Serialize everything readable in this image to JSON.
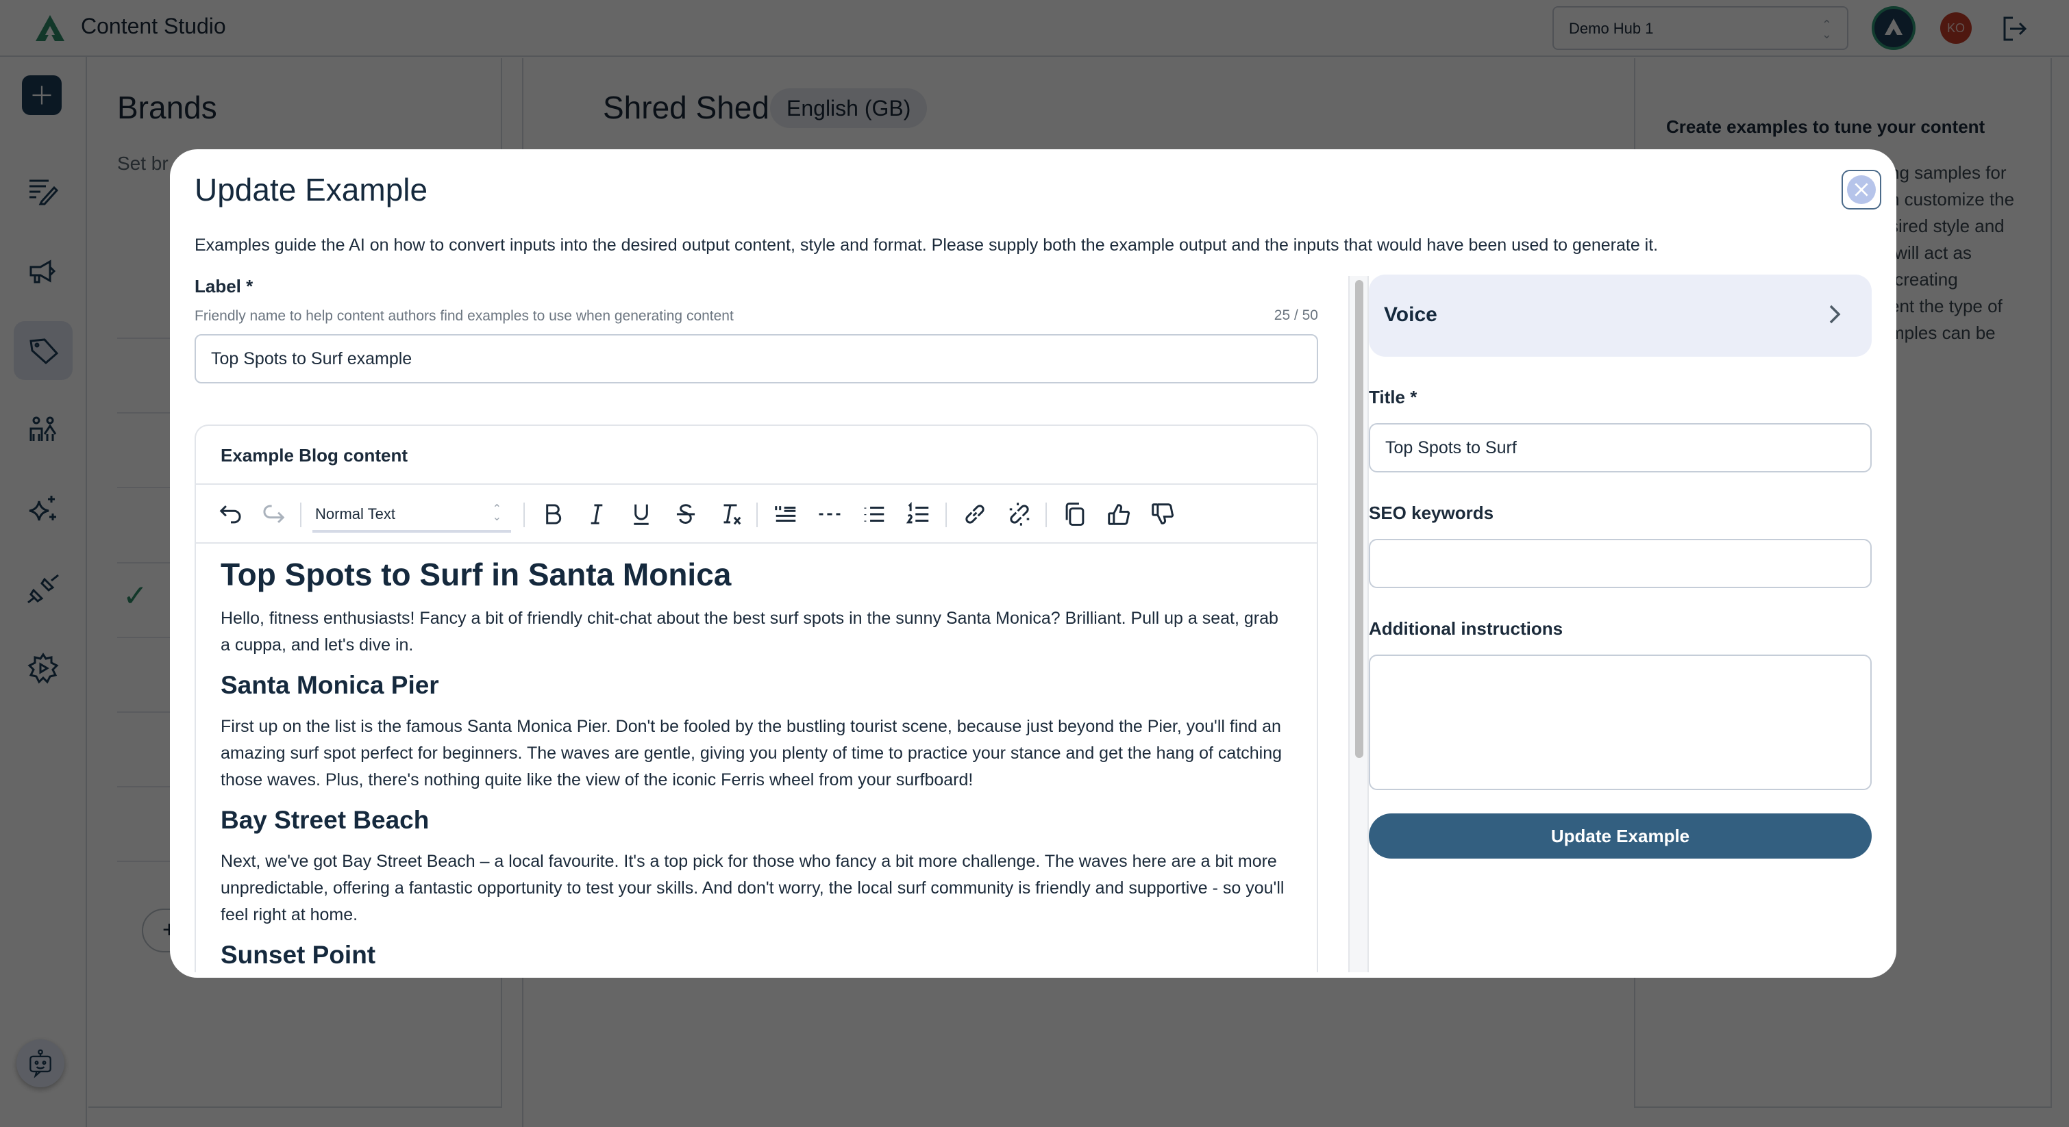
{
  "header": {
    "app_title": "Content Studio",
    "hub_select": {
      "value": "Demo Hub 1"
    },
    "user_initials": "KO"
  },
  "rail": {
    "items": [
      {
        "name": "new",
        "icon": "plus-icon"
      },
      {
        "name": "content",
        "icon": "edit-list-icon"
      },
      {
        "name": "campaigns",
        "icon": "megaphone-icon"
      },
      {
        "name": "brands",
        "icon": "tag-icon",
        "active": true
      },
      {
        "name": "audiences",
        "icon": "people-icon"
      },
      {
        "name": "ai",
        "icon": "sparkles-icon"
      },
      {
        "name": "integrations",
        "icon": "plug-icon"
      },
      {
        "name": "settings",
        "icon": "settings-gear-icon"
      }
    ],
    "assistant_icon": "robot-chat-icon"
  },
  "brands_panel": {
    "title": "Brands",
    "description": "Set br… conte…",
    "add_label": "+"
  },
  "middle_panel": {
    "brand_name": "Shred Shed",
    "language": "English (GB)"
  },
  "right_panel": {
    "title": "Create examples to tune your content",
    "description_lines": [
      "…ng samples for",
      "…n customize the",
      "…sired style and",
      "… will act as",
      "… creating",
      "…ent the type of",
      "…mples can be"
    ]
  },
  "modal": {
    "title": "Update Example",
    "description": "Examples guide the AI on how to convert inputs into the desired output content, style and format. Please supply both the example output and the inputs that would have been used to generate it.",
    "label_field": {
      "label": "Label *",
      "help": "Friendly name to help content authors find examples to use when generating content",
      "counter": "25 / 50",
      "value": "Top Spots to Surf example"
    },
    "editor": {
      "label": "Example Blog content",
      "text_style": "Normal Text",
      "content": {
        "h1": "Top Spots to Surf in Santa Monica",
        "p1": "Hello, fitness enthusiasts! Fancy a bit of friendly chit-chat about the best surf spots in the sunny Santa Monica? Brilliant. Pull up a seat, grab a cuppa, and let's dive in.",
        "h2a": "Santa Monica Pier",
        "p2": "First up on the list is the famous Santa Monica Pier. Don't be fooled by the bustling tourist scene, because just beyond the Pier, you'll find an amazing surf spot perfect for beginners. The waves are gentle, giving you plenty of time to practice your stance and get the hang of catching those waves. Plus, there's nothing quite like the view of the iconic Ferris wheel from your surfboard!",
        "h2b": "Bay Street Beach",
        "p3": "Next, we've got Bay Street Beach – a local favourite. It's a top pick for those who fancy a bit more challenge. The waves here are a bit more unpredictable, offering a fantastic opportunity to test your skills. And don't worry, the local surf community is friendly and supportive - so you'll feel right at home.",
        "h2c": "Sunset Point"
      }
    },
    "inputs": {
      "section": "Voice",
      "title_label": "Title *",
      "title_value": "Top Spots to Surf",
      "seo_label": "SEO keywords",
      "seo_value": "",
      "instructions_label": "Additional instructions",
      "instructions_value": ""
    },
    "submit_label": "Update Example"
  },
  "colors": {
    "primary": "#335f80",
    "brand_green": "#2f9a77",
    "voice_card_bg": "#ebeef8",
    "avatar_red": "#c63c2a"
  }
}
